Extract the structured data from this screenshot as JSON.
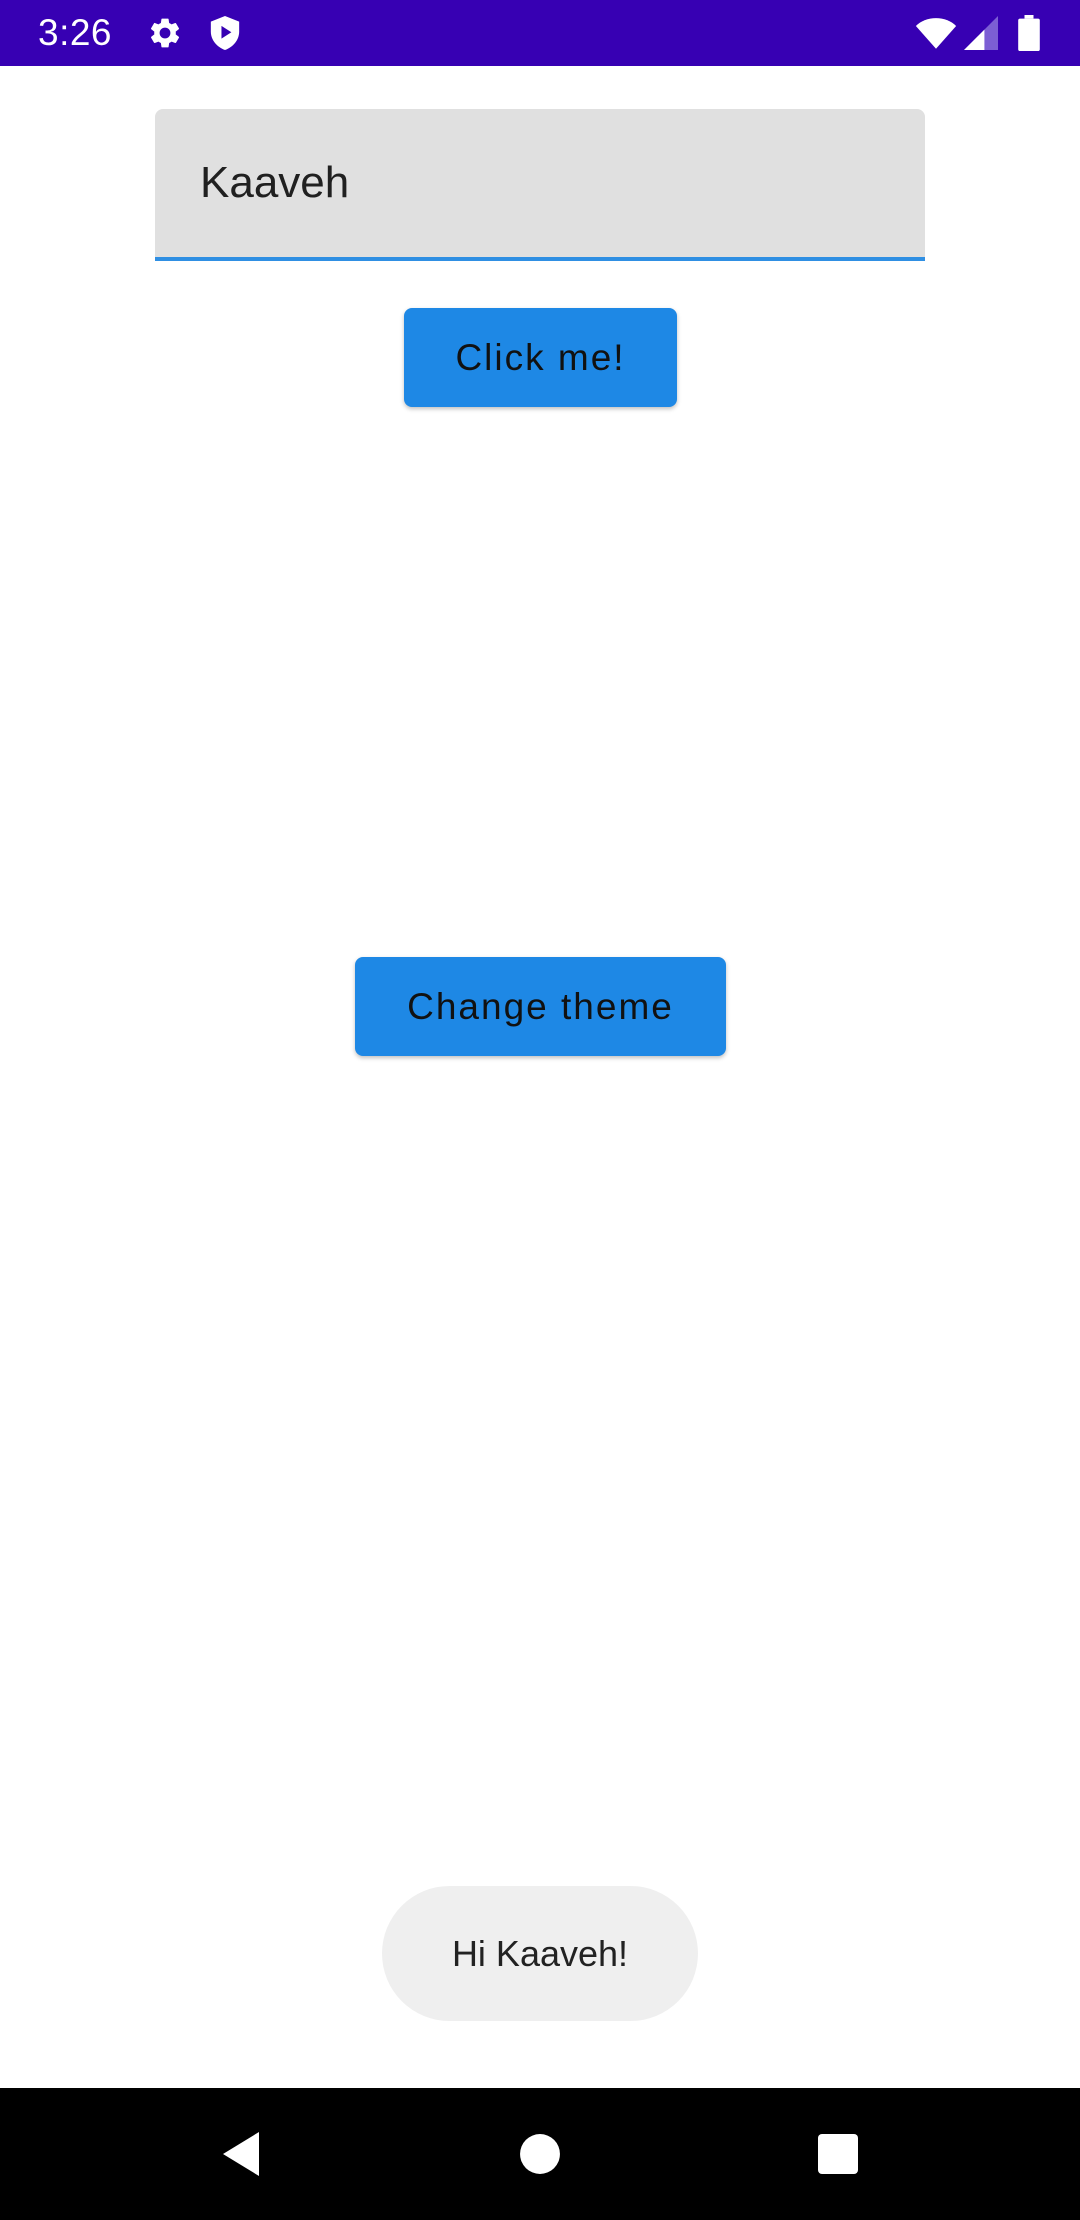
{
  "status_bar": {
    "time": "3:26",
    "icons": [
      "gear-icon",
      "shield-play-icon",
      "wifi-icon",
      "cell-signal-icon",
      "battery-icon"
    ],
    "background_color": "#3700b3"
  },
  "form": {
    "name_field_value": "Kaaveh",
    "accent_color": "#2f8fe3"
  },
  "buttons": {
    "click_label": "Click me!",
    "theme_label": "Change theme",
    "color": "#1e88e5"
  },
  "toast": {
    "message": "Hi Kaaveh!"
  },
  "navigation_bar": {
    "buttons": [
      "back-icon",
      "home-icon",
      "recents-icon"
    ]
  }
}
